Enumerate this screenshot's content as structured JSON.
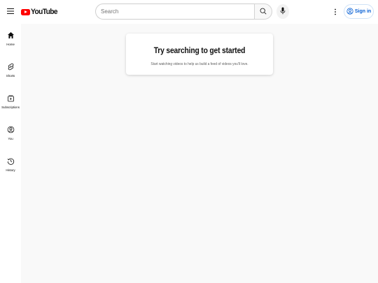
{
  "header": {
    "logo_text": "YouTube",
    "search": {
      "placeholder": "Search",
      "value": ""
    },
    "signin_label": "Sign in",
    "icons": [
      "menu-icon",
      "search-icon",
      "mic-icon",
      "more-vert-icon",
      "account-circle-icon"
    ]
  },
  "sidebar": {
    "items": [
      {
        "label": "Home",
        "icon": "home-icon"
      },
      {
        "label": "Shorts",
        "icon": "shorts-icon"
      },
      {
        "label": "Subscriptions",
        "icon": "subscriptions-icon"
      },
      {
        "label": "You",
        "icon": "you-icon"
      },
      {
        "label": "History",
        "icon": "history-icon"
      }
    ]
  },
  "main": {
    "prompt": {
      "title": "Try searching to get started",
      "subtitle": "Start watching videos to help us build a feed of videos you'll love."
    }
  },
  "colors": {
    "brand_red": "#ff0000",
    "link_blue": "#065fd4",
    "background": "#f9f9f9"
  }
}
